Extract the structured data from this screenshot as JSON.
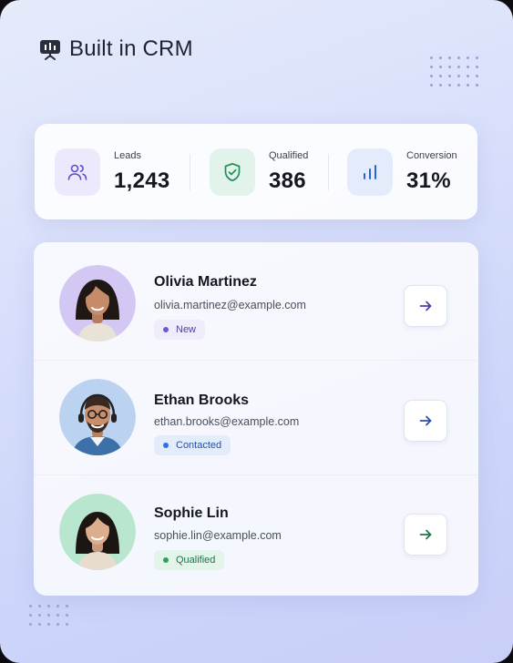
{
  "header": {
    "title": "Built in CRM",
    "icon": "presentation-board-icon"
  },
  "stats": [
    {
      "label": "Leads",
      "value": "1,243",
      "icon": "users-icon",
      "accent": "#5b4fc9"
    },
    {
      "label": "Qualified",
      "value": "386",
      "icon": "shield-check-icon",
      "accent": "#1f8f55"
    },
    {
      "label": "Conversion",
      "value": "31%",
      "icon": "bar-chart-icon",
      "accent": "#2d63d8"
    }
  ],
  "contacts": [
    {
      "name": "Olivia Martinez",
      "email": "olivia.martinez@example.com",
      "status": "New",
      "status_color": "#6b58d8",
      "arrow_color": "#4b3fa6"
    },
    {
      "name": "Ethan Brooks",
      "email": "ethan.brooks@example.com",
      "status": "Contacted",
      "status_color": "#2f6fe6",
      "arrow_color": "#2950a6"
    },
    {
      "name": "Sophie Lin",
      "email": "sophie.lin@example.com",
      "status": "Qualified",
      "status_color": "#2aa35b",
      "arrow_color": "#217347"
    }
  ]
}
